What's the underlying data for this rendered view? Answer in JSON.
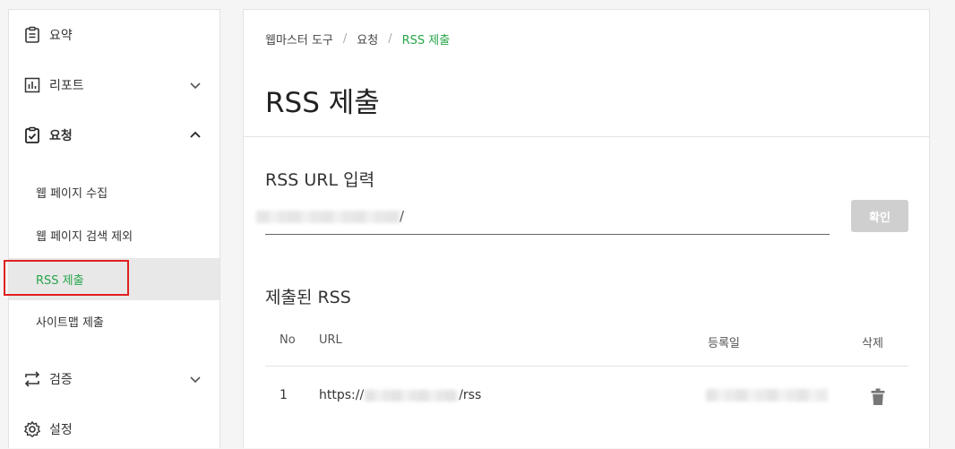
{
  "sidebar": {
    "items": [
      {
        "label": "요약",
        "icon": "clipboard-icon"
      },
      {
        "label": "리포트",
        "icon": "bar-chart-icon",
        "expanded": false
      },
      {
        "label": "요청",
        "icon": "clipboard-check-icon",
        "expanded": true
      },
      {
        "label": "검증",
        "icon": "swap-arrows-icon",
        "expanded": false
      },
      {
        "label": "설정",
        "icon": "gear-icon"
      }
    ],
    "sub_items": [
      {
        "label": "웹 페이지 수집"
      },
      {
        "label": "웹 페이지 검색 제외"
      },
      {
        "label": "RSS 제출",
        "active": true
      },
      {
        "label": "사이트맵 제출"
      }
    ]
  },
  "breadcrumb": {
    "items": [
      "웹마스터 도구",
      "요청",
      "RSS 제출"
    ],
    "separator": "/"
  },
  "page": {
    "title": "RSS 제출"
  },
  "input_section": {
    "title": "RSS URL 입력",
    "input_value_visible": "/",
    "confirm_label": "확인"
  },
  "list_section": {
    "title": "제출된 RSS",
    "columns": [
      "No",
      "URL",
      "등록일",
      "삭제"
    ],
    "rows": [
      {
        "no": "1",
        "url_prefix": "https://",
        "url_suffix": "/rss"
      }
    ]
  },
  "colors": {
    "accent_green": "#27a54a",
    "highlight_red": "#e02020",
    "button_disabled": "#cfcfcf"
  }
}
